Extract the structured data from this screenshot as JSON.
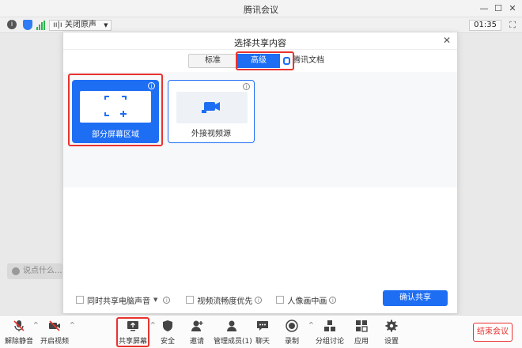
{
  "window": {
    "title": "腾讯会议"
  },
  "infobar": {
    "audio_label": "关闭原声",
    "timer": "01:35"
  },
  "dialog": {
    "title": "选择共享内容",
    "tabs": {
      "standard": "标准",
      "advanced": "高级",
      "docs": "腾讯文档"
    },
    "cards": {
      "partial": "部分屏幕区域",
      "external": "外接视频源"
    },
    "options": {
      "share_sound": "同时共享电脑声音",
      "video_smooth": "视频流畅度优先",
      "portrait": "人像画中画"
    },
    "confirm": "确认共享"
  },
  "chat": {
    "placeholder": "说点什么..."
  },
  "toolbar": {
    "unmute": "解除静音",
    "start_video": "开启视频",
    "share_screen": "共享屏幕",
    "security": "安全",
    "invite": "邀请",
    "members": "管理成员(1)",
    "chat": "聊天",
    "record": "录制",
    "breakout": "分组讨论",
    "apps": "应用",
    "settings": "设置",
    "end_meeting": "结束会议"
  },
  "colors": {
    "accent": "#1e6ef4",
    "highlight": "#e8332f"
  }
}
